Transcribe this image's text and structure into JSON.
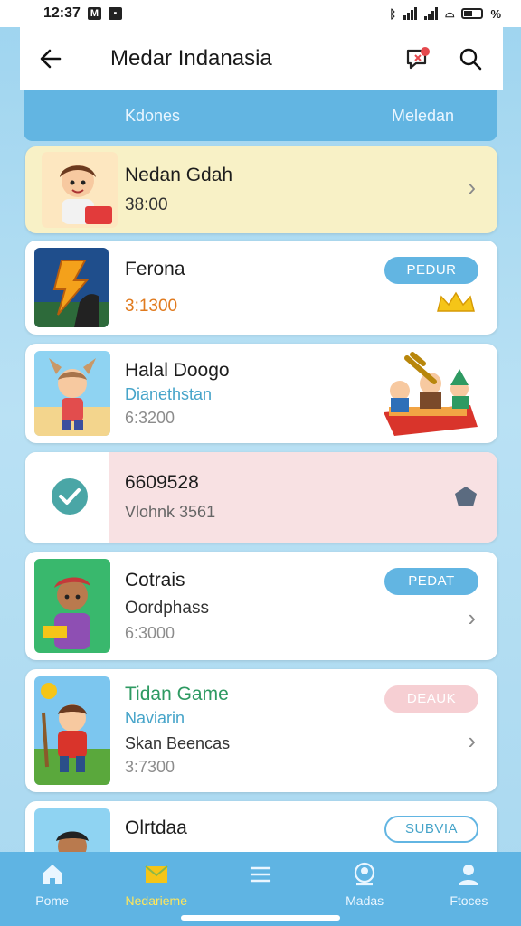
{
  "status_bar": {
    "time": "12:37",
    "battery": "%"
  },
  "app_bar": {
    "title": "Medar Indanasia"
  },
  "tabs": [
    {
      "label": "Kdones"
    },
    {
      "label": "Meledan"
    }
  ],
  "cards": [
    {
      "title": "Nedan Gdah",
      "line2": "38:00"
    },
    {
      "title": "Ferona",
      "line2": "3:1300",
      "badge": "PEDUR"
    },
    {
      "title": "Halal Doogo",
      "line2": "Dianethstan",
      "line3": "6:3200"
    },
    {
      "title": "6609528",
      "line2": "Vlohnk 3561"
    },
    {
      "title": "Cotrais",
      "line2": "Oordphass",
      "line3": "6:3000",
      "badge": "PEDAT"
    },
    {
      "title": "Tidan Game",
      "line2": "Naviarin",
      "line3": "Skan Beencas",
      "line4": "3:7300",
      "badge": "DEAUK"
    },
    {
      "title": "Olrtdaa",
      "badge": "SUBVIA"
    }
  ],
  "bottom_nav": [
    {
      "label": "Pome"
    },
    {
      "label": "Nedarieme"
    },
    {
      "label": ""
    },
    {
      "label": "Madas"
    },
    {
      "label": "Ftoces"
    }
  ],
  "colors": {
    "accent": "#5fb4e3",
    "card_yellow": "#f8f1c6",
    "card_pink": "#f8e1e3",
    "pill_blue": "#62b5e2",
    "pill_pink": "#f6cfd3",
    "green_title": "#2e9a62",
    "orange_value": "#e07a1e",
    "teal_subtitle": "#46a4c9"
  }
}
